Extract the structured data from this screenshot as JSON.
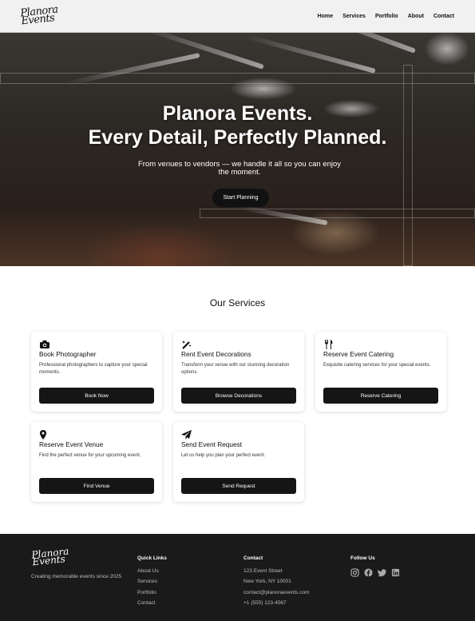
{
  "nav": {
    "logo_line1": "Planora",
    "logo_line2": "Events",
    "links": [
      "Home",
      "Services",
      "Portfolio",
      "About",
      "Contact"
    ]
  },
  "hero": {
    "title_line1": "Planora Events.",
    "title_line2": "Every Detail, Perfectly Planned.",
    "subtitle": "From venues to vendors — we handle it all so you can enjoy the moment.",
    "cta": "Start Planning"
  },
  "services": {
    "title": "Our Services",
    "cards": [
      {
        "icon": "camera-icon",
        "title": "Book Photographer",
        "desc": "Professional photographers to capture your special moments.",
        "button": "Book Now"
      },
      {
        "icon": "magic-wand-icon",
        "title": "Rent Event Decorations",
        "desc": "Transform your venue with our stunning decoration options.",
        "button": "Browse Decorations"
      },
      {
        "icon": "utensils-icon",
        "title": "Reserve Event Catering",
        "desc": "Exquisite catering services for your special events.",
        "button": "Reserve Catering"
      },
      {
        "icon": "map-pin-icon",
        "title": "Reserve Event Venue",
        "desc": "Find the perfect venue for your upcoming event.",
        "button": "Find Venue"
      },
      {
        "icon": "paper-plane-icon",
        "title": "Send Event Request",
        "desc": "Let us help you plan your perfect event.",
        "button": "Send Request"
      }
    ]
  },
  "footer": {
    "logo_line1": "Planora",
    "logo_line2": "Events",
    "tagline": "Creating memorable events since 2025",
    "quick_links_title": "Quick Links",
    "quick_links": [
      "About Us",
      "Services",
      "Portfolio",
      "Contact"
    ],
    "contact_title": "Contact",
    "contact": [
      "123 Event Street",
      "New York, NY 10001",
      "contact@planoraevents.com",
      "+1 (555) 123-4567"
    ],
    "follow_title": "Follow Us",
    "socials": [
      "instagram-icon",
      "facebook-icon",
      "twitter-icon",
      "linkedin-icon"
    ]
  }
}
